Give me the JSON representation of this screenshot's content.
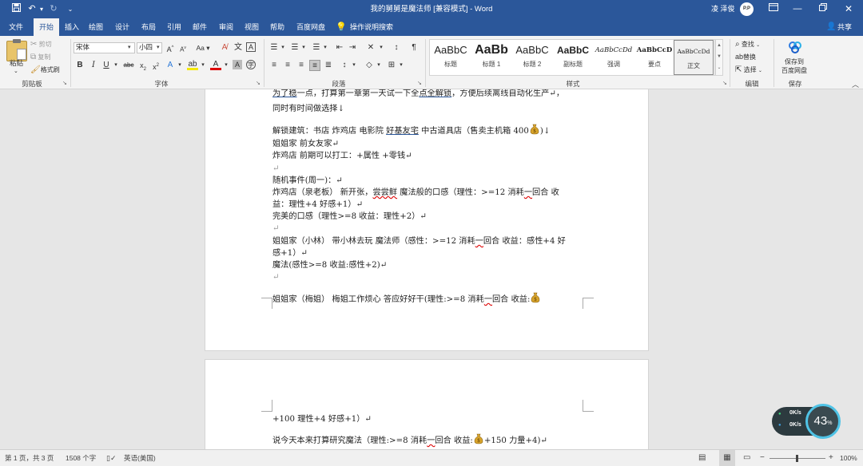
{
  "window": {
    "title": "我的舅舅是魔法师 [兼容模式] - Word",
    "user": "凌 泽俊",
    "avatar_text": "P.P"
  },
  "quick_access": {
    "save": "💾",
    "undo": "↶",
    "redo": "↻",
    "more": "⌄"
  },
  "tabs": [
    "文件",
    "开始",
    "插入",
    "绘图",
    "设计",
    "布局",
    "引用",
    "邮件",
    "审阅",
    "视图",
    "帮助",
    "百度网盘"
  ],
  "tell_me": "操作说明搜索",
  "share": "共享",
  "ribbon": {
    "clipboard": {
      "paste": "粘贴",
      "cut": "剪切",
      "copy": "复制",
      "format_painter": "格式刷",
      "label": "剪贴板"
    },
    "font": {
      "name": "宋体",
      "size": "小四",
      "label": "字体"
    },
    "paragraph": {
      "label": "段落"
    },
    "styles": {
      "label": "样式",
      "items": [
        {
          "sample": "AaBbC",
          "name": "标题"
        },
        {
          "sample": "AaBb",
          "name": "标题 1"
        },
        {
          "sample": "AaBbC",
          "name": "标题 2"
        },
        {
          "sample": "AaBbC",
          "name": "副标题"
        },
        {
          "sample": "AaBbCcDd",
          "name": "强调"
        },
        {
          "sample": "AaBbCcD",
          "name": "要点"
        },
        {
          "sample": "AaBbCcDd",
          "name": "正文"
        }
      ]
    },
    "editing": {
      "find": "查找",
      "replace": "替换",
      "select": "选择",
      "label": "编辑"
    },
    "save": {
      "btn1": "保存到",
      "btn2": "百度网盘",
      "label": "保存"
    }
  },
  "document": {
    "page1": [
      {
        "pre": "",
        "ul": "为了稳",
        "post": "一点，打算第一章第一天试一下全",
        "ul2": "点全解锁",
        "tail": "，方便后续离线自动化生产↵，"
      },
      {
        "text": "同时有时间做选择↓"
      },
      {
        "text_a": "解锁建筑：书店  炸鸡店  电影院  ",
        "ul": "好基友宅",
        "text_b": "  中古道具店（售卖主机箱    400",
        "tail": ")↓"
      },
      {
        "text": "姐姐家  前女友家↵"
      },
      {
        "text": "炸鸡店  前期可以打工：+属性  +零钱↵"
      },
      {
        "text": "↵"
      },
      {
        "text": "随机事件(周一)：↵"
      },
      {
        "text_a": "炸鸡店（泉老板）  新开张，",
        "wavy": "尝尝鲜",
        "text_b": "  魔法般的口感（理性：>=12  消耗",
        "wavy2": "一",
        "text_c": "回合  收"
      },
      {
        "text": "益：理性+4  好感+1）↵"
      },
      {
        "text": "完美的口感（理性>=8  收益：理性+2）↵"
      },
      {
        "text": "↵"
      },
      {
        "text_a": "姐姐家（小林）  带小林去玩  魔法师（感性：>=12  消耗",
        "wavy": "一",
        "text_b": "回合  收益：感性+4  好"
      },
      {
        "text": "感+1）↵"
      },
      {
        "text": "魔法(感性>=8  收益:感性+2)↵"
      },
      {
        "text": "↵"
      },
      {
        "text_a": "姐姐家（梅姐）  梅姐工作烦心    答应好好干(理性:>=8  消耗",
        "wavy": "一",
        "text_b": "回合  收益:"
      }
    ],
    "page2": [
      {
        "text": "+100  理性+4  好感+1）↵"
      },
      {
        "text_a": "说今天本来打算研究魔法（理性:>=8  消耗",
        "wavy": "一",
        "text_b": "回合  收益:",
        "text_c": "+150  力量+4)↵"
      }
    ]
  },
  "status": {
    "page": "第 1 页，共 3 页",
    "words": "1508 个字",
    "lang": "英语(美国)",
    "zoom": "100%",
    "minus": "−",
    "plus": "+"
  },
  "overlay": {
    "up": "0K/s",
    "down": "0K/s",
    "percent": "43",
    "unit": "%"
  }
}
